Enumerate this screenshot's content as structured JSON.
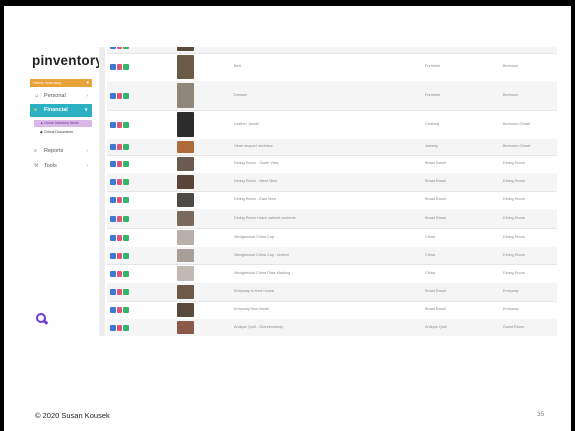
{
  "app": {
    "logo": "pinventory",
    "logo_mark": "*",
    "menu_label": "Home Inventory",
    "menu_chevron": "▾"
  },
  "sidebar": {
    "items": [
      {
        "label": "Personal",
        "icon": "user-icon",
        "icon_glyph": "☺",
        "arrow": "›"
      },
      {
        "label": "Financial",
        "icon": "coin-icon",
        "icon_glyph": "●",
        "arrow": "∨"
      },
      {
        "label": "Reports",
        "icon": "bar-chart-icon",
        "icon_glyph": "≡",
        "arrow": "›"
      },
      {
        "label": "Tools",
        "icon": "wrench-icon",
        "icon_glyph": "⚒",
        "arrow": "›"
      }
    ],
    "sub_items": [
      {
        "label": "▲ Home Inventory Items"
      },
      {
        "label": "◆ Critical Documents"
      }
    ]
  },
  "colors": {
    "accent": "#2bb0c4",
    "menu_tag": "#e8a23a",
    "submenu_active": "#d9b8e8",
    "edit": "#3c7ad8",
    "delete": "#e0567a",
    "view": "#35b56a",
    "brand_q": "#6b3bd6"
  },
  "table": {
    "rows": [
      {
        "name": "",
        "category": "",
        "room": "",
        "thumb_color": "#5a4a3a"
      },
      {
        "name": "Bed",
        "category": "Furniture",
        "room": "Bedroom",
        "thumb_color": "#6b5a48"
      },
      {
        "name": "Dresser",
        "category": "Furniture",
        "room": "Bedroom",
        "thumb_color": "#8e8678"
      },
      {
        "name": "Leather Jacket",
        "category": "Clothing",
        "room": "Bedroom Closet",
        "thumb_color": "#2c2c2c"
      },
      {
        "name": "Heart shaped necklace",
        "category": "Jewelry",
        "room": "Bedroom Closet",
        "thumb_color": "#b06a3a"
      },
      {
        "name": "Dining Room - South View",
        "category": "Broad Brush",
        "room": "Dining Room",
        "thumb_color": "#6a5a50"
      },
      {
        "name": "Dining Room - West View",
        "category": "Broad Brush",
        "room": "Dining Room",
        "thumb_color": "#5a4438"
      },
      {
        "name": "Dining Room - East View",
        "category": "Broad Brush",
        "room": "Dining Room",
        "thumb_color": "#4e4a46"
      },
      {
        "name": "Dining Room Hutch cabinet contents",
        "category": "Broad Brush",
        "room": "Dining Room",
        "thumb_color": "#7a6a5e"
      },
      {
        "name": "Wedgewood China Cup",
        "category": "China",
        "room": "Dining Room",
        "thumb_color": "#b8b0a8"
      },
      {
        "name": "Wedgewood China Cup - bottom",
        "category": "China",
        "room": "Dining Room",
        "thumb_color": "#a8a098"
      },
      {
        "name": "Wedgewood China Plate Marking",
        "category": "China",
        "room": "Dining Room",
        "thumb_color": "#c0bab2"
      },
      {
        "name": "Entryway to front house",
        "category": "Broad Brush",
        "room": "Entryway",
        "thumb_color": "#6e5846"
      },
      {
        "name": "Entryway from inside",
        "category": "Broad Brush",
        "room": "Entryway",
        "thumb_color": "#5a4a3c"
      },
      {
        "name": "Antique Quilt - Grandmoderly",
        "category": "Antique Quilt",
        "room": "Guest Room",
        "thumb_color": "#8a5a4a"
      }
    ]
  },
  "footer": {
    "copyright": "© 2020 Susan Kousek",
    "page": "35"
  }
}
